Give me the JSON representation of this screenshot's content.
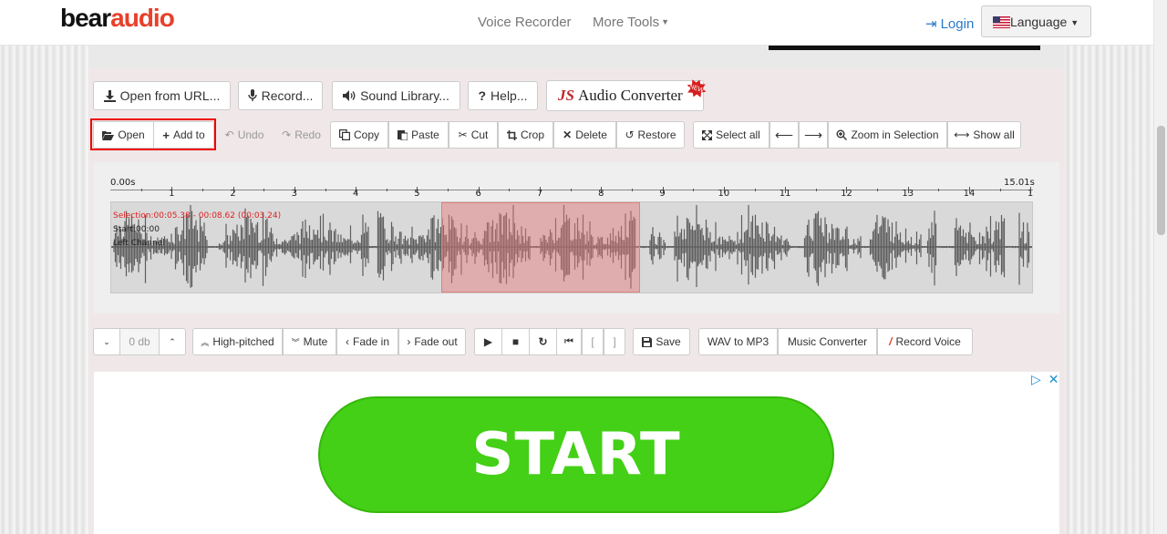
{
  "brand": {
    "logo_part1": "bear",
    "logo_part2": "audio"
  },
  "nav": {
    "voice_recorder": "Voice Recorder",
    "more_tools": "More Tools",
    "login": "Login",
    "language": "Language"
  },
  "top_buttons": {
    "open_url": "Open from URL...",
    "record": "Record...",
    "sound_library": "Sound Library...",
    "help": "Help...",
    "converter_js": "JS",
    "converter_text": "Audio Converter",
    "converter_badge": "NEW"
  },
  "toolbar": {
    "open": "Open",
    "add_to": "Add to",
    "undo": "Undo",
    "redo": "Redo",
    "copy": "Copy",
    "paste": "Paste",
    "cut": "Cut",
    "crop": "Crop",
    "delete": "Delete",
    "restore": "Restore",
    "select_all": "Select all",
    "zoom_selection": "Zoom in Selection",
    "show_all": "Show all"
  },
  "timeline": {
    "start_label": "0.00s",
    "end_label": "15.01s",
    "ticks": [
      "1",
      "2",
      "3",
      "4",
      "5",
      "6",
      "7",
      "8",
      "9",
      "10",
      "11",
      "12",
      "13",
      "14",
      "1"
    ]
  },
  "waveform": {
    "selection_text": "Selection:00:05.38 - 00:08.62 (00:03.24)",
    "start_text": "Start:00:00",
    "channel_text": "Left Channel",
    "duration_seconds": 15.01,
    "selection_start": 5.38,
    "selection_end": 8.62
  },
  "effects": {
    "db_value": "0 db",
    "high_pitched": "High-pitched",
    "mute": "Mute",
    "fade_in": "Fade in",
    "fade_out": "Fade out",
    "bracket_left": "[",
    "bracket_right": "]",
    "save": "Save",
    "wav_to_mp3": "WAV to MP3",
    "music_converter": "Music Converter",
    "record_voice": "Record Voice"
  },
  "ad": {
    "cta": "START"
  },
  "colors": {
    "accent_red": "#e8402a",
    "link_blue": "#2a7ac7",
    "ad_green": "#43d016",
    "selection": "#e67878"
  }
}
